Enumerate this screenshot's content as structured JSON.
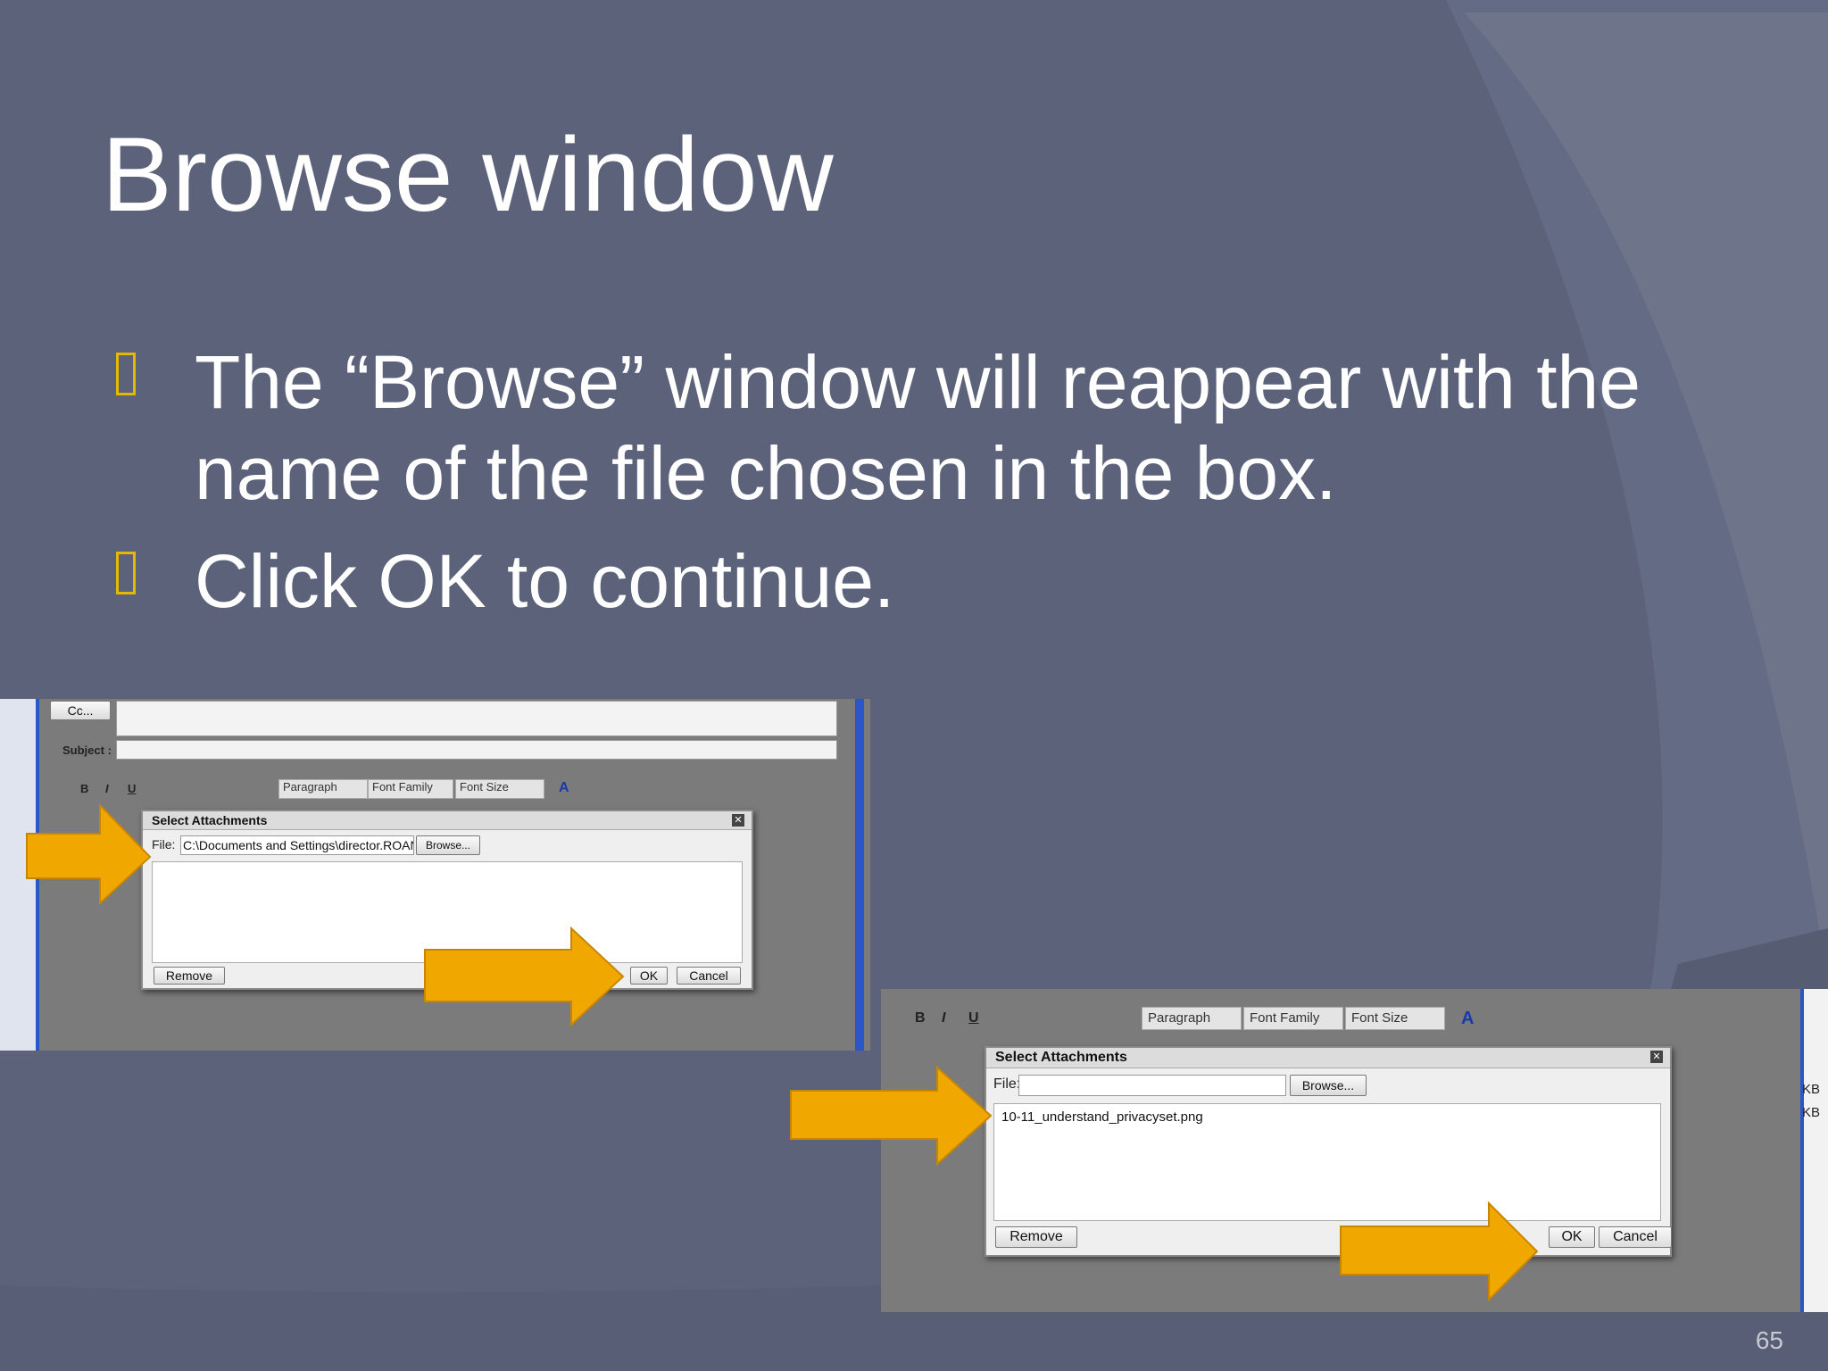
{
  "slide": {
    "title": "Browse window",
    "bullets": [
      "The “Browse” window will reappear with the name of the file chosen in the box.",
      "Click OK to continue."
    ],
    "page_number": "65"
  },
  "colors": {
    "background": "#5b6279",
    "arc": "#6a7088",
    "arrow": "#f0a800",
    "bullet": "#e6b800"
  },
  "screenshot1": {
    "cc_button": "Cc...",
    "subject_label": "Subject :",
    "toolbar": {
      "paragraph": "Paragraph",
      "font_family": "Font Family",
      "font_size": "Font Size"
    },
    "dialog": {
      "title": "Select Attachments",
      "file_label": "File:",
      "file_value": "C:\\Documents and Settings\\director.ROAN",
      "browse_button": "Browse...",
      "remove_button": "Remove",
      "ok_button": "OK",
      "cancel_button": "Cancel"
    }
  },
  "screenshot2": {
    "toolbar": {
      "paragraph": "Paragraph",
      "font_family": "Font Family",
      "font_size": "Font Size"
    },
    "side_labels": [
      "KB",
      "KB"
    ],
    "dialog": {
      "title": "Select Attachments",
      "file_label": "File:",
      "file_value": "",
      "browse_button": "Browse...",
      "attachment": "10-11_understand_privacyset.png",
      "remove_button": "Remove",
      "ok_button": "OK",
      "cancel_button": "Cancel"
    }
  }
}
